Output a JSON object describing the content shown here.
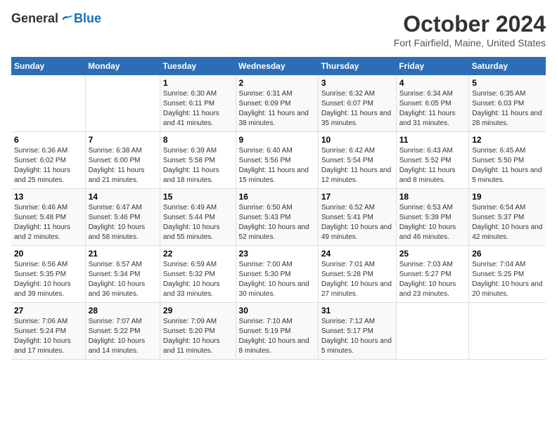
{
  "logo": {
    "general": "General",
    "blue": "Blue"
  },
  "title": "October 2024",
  "location": "Fort Fairfield, Maine, United States",
  "weekdays": [
    "Sunday",
    "Monday",
    "Tuesday",
    "Wednesday",
    "Thursday",
    "Friday",
    "Saturday"
  ],
  "weeks": [
    [
      {
        "day": "",
        "sunrise": "",
        "sunset": "",
        "daylight": ""
      },
      {
        "day": "",
        "sunrise": "",
        "sunset": "",
        "daylight": ""
      },
      {
        "day": "1",
        "sunrise": "Sunrise: 6:30 AM",
        "sunset": "Sunset: 6:11 PM",
        "daylight": "Daylight: 11 hours and 41 minutes."
      },
      {
        "day": "2",
        "sunrise": "Sunrise: 6:31 AM",
        "sunset": "Sunset: 6:09 PM",
        "daylight": "Daylight: 11 hours and 38 minutes."
      },
      {
        "day": "3",
        "sunrise": "Sunrise: 6:32 AM",
        "sunset": "Sunset: 6:07 PM",
        "daylight": "Daylight: 11 hours and 35 minutes."
      },
      {
        "day": "4",
        "sunrise": "Sunrise: 6:34 AM",
        "sunset": "Sunset: 6:05 PM",
        "daylight": "Daylight: 11 hours and 31 minutes."
      },
      {
        "day": "5",
        "sunrise": "Sunrise: 6:35 AM",
        "sunset": "Sunset: 6:03 PM",
        "daylight": "Daylight: 11 hours and 28 minutes."
      }
    ],
    [
      {
        "day": "6",
        "sunrise": "Sunrise: 6:36 AM",
        "sunset": "Sunset: 6:02 PM",
        "daylight": "Daylight: 11 hours and 25 minutes."
      },
      {
        "day": "7",
        "sunrise": "Sunrise: 6:38 AM",
        "sunset": "Sunset: 6:00 PM",
        "daylight": "Daylight: 11 hours and 21 minutes."
      },
      {
        "day": "8",
        "sunrise": "Sunrise: 6:39 AM",
        "sunset": "Sunset: 5:58 PM",
        "daylight": "Daylight: 11 hours and 18 minutes."
      },
      {
        "day": "9",
        "sunrise": "Sunrise: 6:40 AM",
        "sunset": "Sunset: 5:56 PM",
        "daylight": "Daylight: 11 hours and 15 minutes."
      },
      {
        "day": "10",
        "sunrise": "Sunrise: 6:42 AM",
        "sunset": "Sunset: 5:54 PM",
        "daylight": "Daylight: 11 hours and 12 minutes."
      },
      {
        "day": "11",
        "sunrise": "Sunrise: 6:43 AM",
        "sunset": "Sunset: 5:52 PM",
        "daylight": "Daylight: 11 hours and 8 minutes."
      },
      {
        "day": "12",
        "sunrise": "Sunrise: 6:45 AM",
        "sunset": "Sunset: 5:50 PM",
        "daylight": "Daylight: 11 hours and 5 minutes."
      }
    ],
    [
      {
        "day": "13",
        "sunrise": "Sunrise: 6:46 AM",
        "sunset": "Sunset: 5:48 PM",
        "daylight": "Daylight: 11 hours and 2 minutes."
      },
      {
        "day": "14",
        "sunrise": "Sunrise: 6:47 AM",
        "sunset": "Sunset: 5:46 PM",
        "daylight": "Daylight: 10 hours and 58 minutes."
      },
      {
        "day": "15",
        "sunrise": "Sunrise: 6:49 AM",
        "sunset": "Sunset: 5:44 PM",
        "daylight": "Daylight: 10 hours and 55 minutes."
      },
      {
        "day": "16",
        "sunrise": "Sunrise: 6:50 AM",
        "sunset": "Sunset: 5:43 PM",
        "daylight": "Daylight: 10 hours and 52 minutes."
      },
      {
        "day": "17",
        "sunrise": "Sunrise: 6:52 AM",
        "sunset": "Sunset: 5:41 PM",
        "daylight": "Daylight: 10 hours and 49 minutes."
      },
      {
        "day": "18",
        "sunrise": "Sunrise: 6:53 AM",
        "sunset": "Sunset: 5:39 PM",
        "daylight": "Daylight: 10 hours and 46 minutes."
      },
      {
        "day": "19",
        "sunrise": "Sunrise: 6:54 AM",
        "sunset": "Sunset: 5:37 PM",
        "daylight": "Daylight: 10 hours and 42 minutes."
      }
    ],
    [
      {
        "day": "20",
        "sunrise": "Sunrise: 6:56 AM",
        "sunset": "Sunset: 5:35 PM",
        "daylight": "Daylight: 10 hours and 39 minutes."
      },
      {
        "day": "21",
        "sunrise": "Sunrise: 6:57 AM",
        "sunset": "Sunset: 5:34 PM",
        "daylight": "Daylight: 10 hours and 36 minutes."
      },
      {
        "day": "22",
        "sunrise": "Sunrise: 6:59 AM",
        "sunset": "Sunset: 5:32 PM",
        "daylight": "Daylight: 10 hours and 33 minutes."
      },
      {
        "day": "23",
        "sunrise": "Sunrise: 7:00 AM",
        "sunset": "Sunset: 5:30 PM",
        "daylight": "Daylight: 10 hours and 30 minutes."
      },
      {
        "day": "24",
        "sunrise": "Sunrise: 7:01 AM",
        "sunset": "Sunset: 5:28 PM",
        "daylight": "Daylight: 10 hours and 27 minutes."
      },
      {
        "day": "25",
        "sunrise": "Sunrise: 7:03 AM",
        "sunset": "Sunset: 5:27 PM",
        "daylight": "Daylight: 10 hours and 23 minutes."
      },
      {
        "day": "26",
        "sunrise": "Sunrise: 7:04 AM",
        "sunset": "Sunset: 5:25 PM",
        "daylight": "Daylight: 10 hours and 20 minutes."
      }
    ],
    [
      {
        "day": "27",
        "sunrise": "Sunrise: 7:06 AM",
        "sunset": "Sunset: 5:24 PM",
        "daylight": "Daylight: 10 hours and 17 minutes."
      },
      {
        "day": "28",
        "sunrise": "Sunrise: 7:07 AM",
        "sunset": "Sunset: 5:22 PM",
        "daylight": "Daylight: 10 hours and 14 minutes."
      },
      {
        "day": "29",
        "sunrise": "Sunrise: 7:09 AM",
        "sunset": "Sunset: 5:20 PM",
        "daylight": "Daylight: 10 hours and 11 minutes."
      },
      {
        "day": "30",
        "sunrise": "Sunrise: 7:10 AM",
        "sunset": "Sunset: 5:19 PM",
        "daylight": "Daylight: 10 hours and 8 minutes."
      },
      {
        "day": "31",
        "sunrise": "Sunrise: 7:12 AM",
        "sunset": "Sunset: 5:17 PM",
        "daylight": "Daylight: 10 hours and 5 minutes."
      },
      {
        "day": "",
        "sunrise": "",
        "sunset": "",
        "daylight": ""
      },
      {
        "day": "",
        "sunrise": "",
        "sunset": "",
        "daylight": ""
      }
    ]
  ]
}
